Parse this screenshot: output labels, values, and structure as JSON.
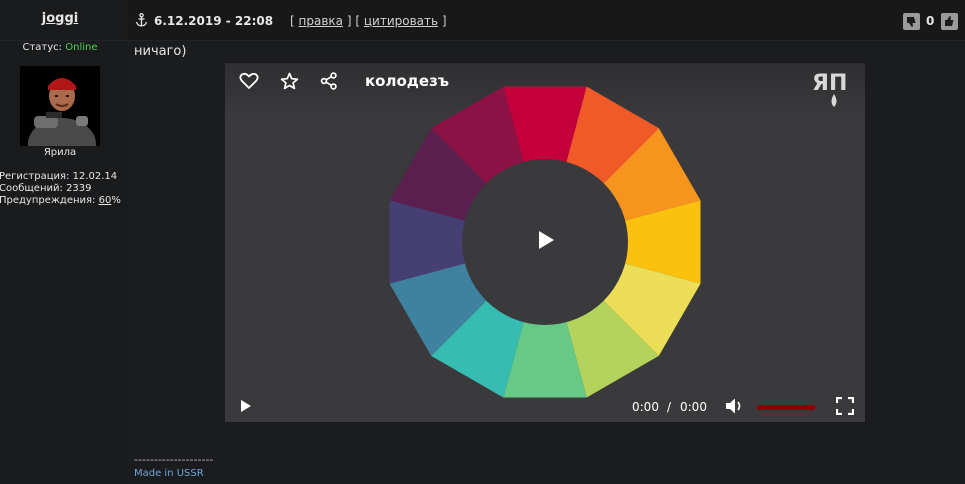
{
  "user": {
    "name": "joggi",
    "status_label": "Статус:",
    "status_value": "Online",
    "rank": "Ярила",
    "reg_label": "Регистрация:",
    "reg_value": "12.02.14",
    "msgs_label": "Сообщений:",
    "msgs_value": "2339",
    "warn_label": "Предупреждения:",
    "warn_value": "60",
    "warn_suffix": "%"
  },
  "post": {
    "datetime": "6.12.2019 - 22:08",
    "action_open": "[",
    "edit_label": "правка",
    "action_mid": "] [",
    "quote_label": "цитировать",
    "action_close": "]",
    "vote_count": "0",
    "text": "ничаго)",
    "signature_line": "--------------------",
    "signature_text": "Made in USSR"
  },
  "video": {
    "title": "колодезъ",
    "logo_text": "ЯП",
    "time_current": "0:00",
    "time_sep": "/",
    "time_total": "0:00",
    "volume_color": "#8b0000",
    "wheel_colors": [
      "#c4003a",
      "#f05a28",
      "#f7941d",
      "#fcc10f",
      "#ecdf57",
      "#b3d35c",
      "#66c985",
      "#37bcb2",
      "#3e82a0",
      "#453f73",
      "#5a1f4f",
      "#8c1245"
    ]
  },
  "colors": {
    "online": "#4fd04f",
    "link": "#6fa3d6",
    "background": "#1b1c1e"
  }
}
